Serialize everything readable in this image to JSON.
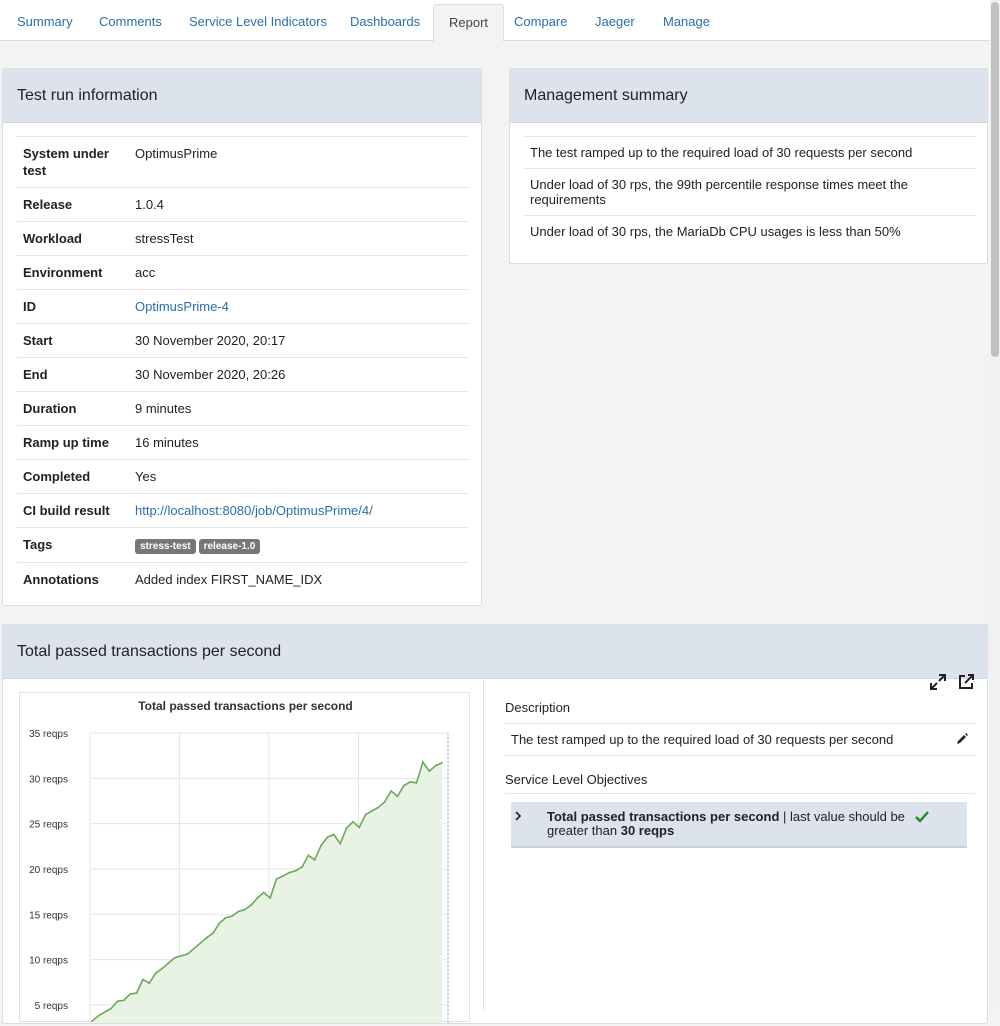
{
  "tabs": [
    {
      "label": "Summary",
      "active": false
    },
    {
      "label": "Comments",
      "active": false
    },
    {
      "label": "Service Level Indicators",
      "active": false
    },
    {
      "label": "Dashboards",
      "active": false
    },
    {
      "label": "Report",
      "active": true
    },
    {
      "label": "Compare",
      "active": false
    },
    {
      "label": "Jaeger",
      "active": false
    },
    {
      "label": "Manage",
      "active": false
    }
  ],
  "test_run": {
    "title": "Test run information",
    "rows": [
      {
        "key": "System under test",
        "value": "OptimusPrime"
      },
      {
        "key": "Release",
        "value": "1.0.4"
      },
      {
        "key": "Workload",
        "value": "stressTest"
      },
      {
        "key": "Environment",
        "value": "acc"
      },
      {
        "key": "ID",
        "value": "OptimusPrime-4",
        "link": true
      },
      {
        "key": "Start",
        "value": "30 November 2020, 20:17"
      },
      {
        "key": "End",
        "value": "30 November 2020, 20:26"
      },
      {
        "key": "Duration",
        "value": "9 minutes"
      },
      {
        "key": "Ramp up time",
        "value": "16 minutes"
      },
      {
        "key": "Completed",
        "value": "Yes"
      },
      {
        "key": "CI build result",
        "value": "http://localhost:8080/job/OptimusPrime/4/",
        "link": true
      },
      {
        "key": "Tags",
        "tags": [
          "stress-test",
          "release-1.0"
        ]
      },
      {
        "key": "Annotations",
        "value": "Added index FIRST_NAME_IDX"
      }
    ]
  },
  "management_summary": {
    "title": "Management summary",
    "items": [
      "The test ramped up to the required load of 30 requests per second",
      "Under load of 30 rps, the 99th percentile response times meet the requirements",
      "Under load of 30 rps, the MariaDb CPU usages is less than 50%"
    ]
  },
  "tps_panel": {
    "title": "Total passed transactions per second",
    "description_label": "Description",
    "description": "The test ramped up to the required load of 30 requests per second",
    "slo_label": "Service Level Objectives",
    "slo": {
      "metric": "Total passed transactions per second",
      "separator": " | ",
      "condition": "last value should be greater than",
      "threshold": "30 reqps"
    }
  },
  "colors": {
    "accent": "#2a6eb0",
    "series": "#6aaa5a",
    "series_fill": "#e8f3e3",
    "check": "#1a8a2a",
    "header_bg": "#dde3ec"
  },
  "chart_data": {
    "type": "area",
    "title": "Total passed transactions per second",
    "xlabel": "",
    "ylabel": "",
    "y_ticks": [
      "5 reqps",
      "10 reqps",
      "15 reqps",
      "20 reqps",
      "25 reqps",
      "30 reqps",
      "35 reqps"
    ],
    "ylim": [
      3,
      35
    ],
    "grid": true,
    "series": [
      {
        "values": [
          3.2,
          3.8,
          4.2,
          4.6,
          5.4,
          5.5,
          6.2,
          6.3,
          7.8,
          7.4,
          8.5,
          9.0,
          9.6,
          10.2,
          10.4,
          10.6,
          11.2,
          11.8,
          12.4,
          12.9,
          14.0,
          14.6,
          14.8,
          15.3,
          15.5,
          16.0,
          16.8,
          17.4,
          16.8,
          18.9,
          19.2,
          19.6,
          19.8,
          20.2,
          21.5,
          21.0,
          22.6,
          23.5,
          23.8,
          22.8,
          24.5,
          25.2,
          24.6,
          26.0,
          26.4,
          26.8,
          27.4,
          28.6,
          28.0,
          29.2,
          29.6,
          29.5,
          31.8,
          30.8,
          31.4,
          31.7
        ]
      }
    ]
  }
}
